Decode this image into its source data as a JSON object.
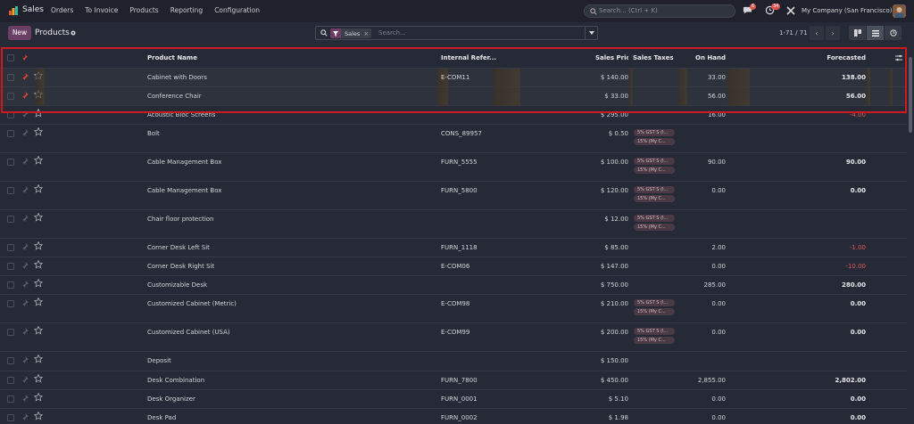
{
  "navbar": {
    "app_name": "Sales",
    "menu": [
      "Orders",
      "To Invoice",
      "Products",
      "Reporting",
      "Configuration"
    ],
    "search_placeholder": "Search... (Ctrl + K)",
    "chat_count": "6",
    "activity_count": "34",
    "company": "My Company (San Francisco)"
  },
  "control": {
    "new_label": "New",
    "breadcrumb": "Products",
    "facet_label": "Sales",
    "search_placeholder": "Search...",
    "pager": "1-71 / 71"
  },
  "columns": {
    "name": "Product Name",
    "ref": "Internal Refer...",
    "price": "Sales Price",
    "taxes": "Sales Taxes",
    "onhand": "On Hand",
    "forecast": "Forecasted"
  },
  "rows": [
    {
      "name": "Cabinet with Doors",
      "ref": "E-COM11",
      "price": "$ 140.00",
      "taxes": [],
      "onhand": "33.00",
      "forecast": "138.00",
      "pinned": true
    },
    {
      "name": "Conference Chair",
      "ref": "",
      "price": "$ 33.00",
      "taxes": [],
      "onhand": "56.00",
      "forecast": "56.00",
      "pinned": true
    },
    {
      "name": "Acoustic Bloc Screens",
      "ref": "",
      "price": "$ 295.00",
      "taxes": [],
      "onhand": "16.00",
      "forecast": "-4.00",
      "pinned": false
    },
    {
      "name": "Bolt",
      "ref": "CONS_89957",
      "price": "$ 0.50",
      "taxes": [
        "5% GST S (I...",
        "15% (My C..."
      ],
      "onhand": "",
      "forecast": "",
      "pinned": false
    },
    {
      "name": "Cable Management Box",
      "ref": "FURN_5555",
      "price": "$ 100.00",
      "taxes": [
        "5% GST S (I...",
        "15% (My C..."
      ],
      "onhand": "90.00",
      "forecast": "90.00",
      "pinned": false
    },
    {
      "name": "Cable Management Box",
      "ref": "FURN_5800",
      "price": "$ 120.00",
      "taxes": [
        "5% GST S (I...",
        "15% (My C..."
      ],
      "onhand": "0.00",
      "forecast": "0.00",
      "pinned": false
    },
    {
      "name": "Chair floor protection",
      "ref": "",
      "price": "$ 12.00",
      "taxes": [
        "5% GST S (I...",
        "15% (My C..."
      ],
      "onhand": "",
      "forecast": "",
      "pinned": false
    },
    {
      "name": "Corner Desk Left Sit",
      "ref": "FURN_1118",
      "price": "$ 85.00",
      "taxes": [],
      "onhand": "2.00",
      "forecast": "-1.00",
      "pinned": false
    },
    {
      "name": "Corner Desk Right Sit",
      "ref": "E-COM06",
      "price": "$ 147.00",
      "taxes": [],
      "onhand": "0.00",
      "forecast": "-10.00",
      "pinned": false
    },
    {
      "name": "Customizable Desk",
      "ref": "",
      "price": "$ 750.00",
      "taxes": [],
      "onhand": "285.00",
      "forecast": "280.00",
      "pinned": false
    },
    {
      "name": "Customized Cabinet (Metric)",
      "ref": "E-COM98",
      "price": "$ 210.00",
      "taxes": [
        "5% GST S (I...",
        "15% (My C..."
      ],
      "onhand": "0.00",
      "forecast": "0.00",
      "pinned": false
    },
    {
      "name": "Customized Cabinet (USA)",
      "ref": "E-COM99",
      "price": "$ 200.00",
      "taxes": [
        "5% GST S (I...",
        "15% (My C..."
      ],
      "onhand": "0.00",
      "forecast": "0.00",
      "pinned": false
    },
    {
      "name": "Deposit",
      "ref": "",
      "price": "$ 150.00",
      "taxes": [],
      "onhand": "",
      "forecast": "",
      "pinned": false
    },
    {
      "name": "Desk Combination",
      "ref": "FURN_7800",
      "price": "$ 450.00",
      "taxes": [],
      "onhand": "2,855.00",
      "forecast": "2,802.00",
      "pinned": false
    },
    {
      "name": "Desk Organizer",
      "ref": "FURN_0001",
      "price": "$ 5.10",
      "taxes": [],
      "onhand": "0.00",
      "forecast": "0.00",
      "pinned": false
    },
    {
      "name": "Desk Pad",
      "ref": "FURN_0002",
      "price": "$ 1.98",
      "taxes": [],
      "onhand": "0.00",
      "forecast": "0.00",
      "pinned": false
    }
  ],
  "colors": {
    "accent": "#6a3f63",
    "negative": "#e05b5b",
    "highlight": "#d0191f",
    "pin_active": "#e0442f"
  }
}
